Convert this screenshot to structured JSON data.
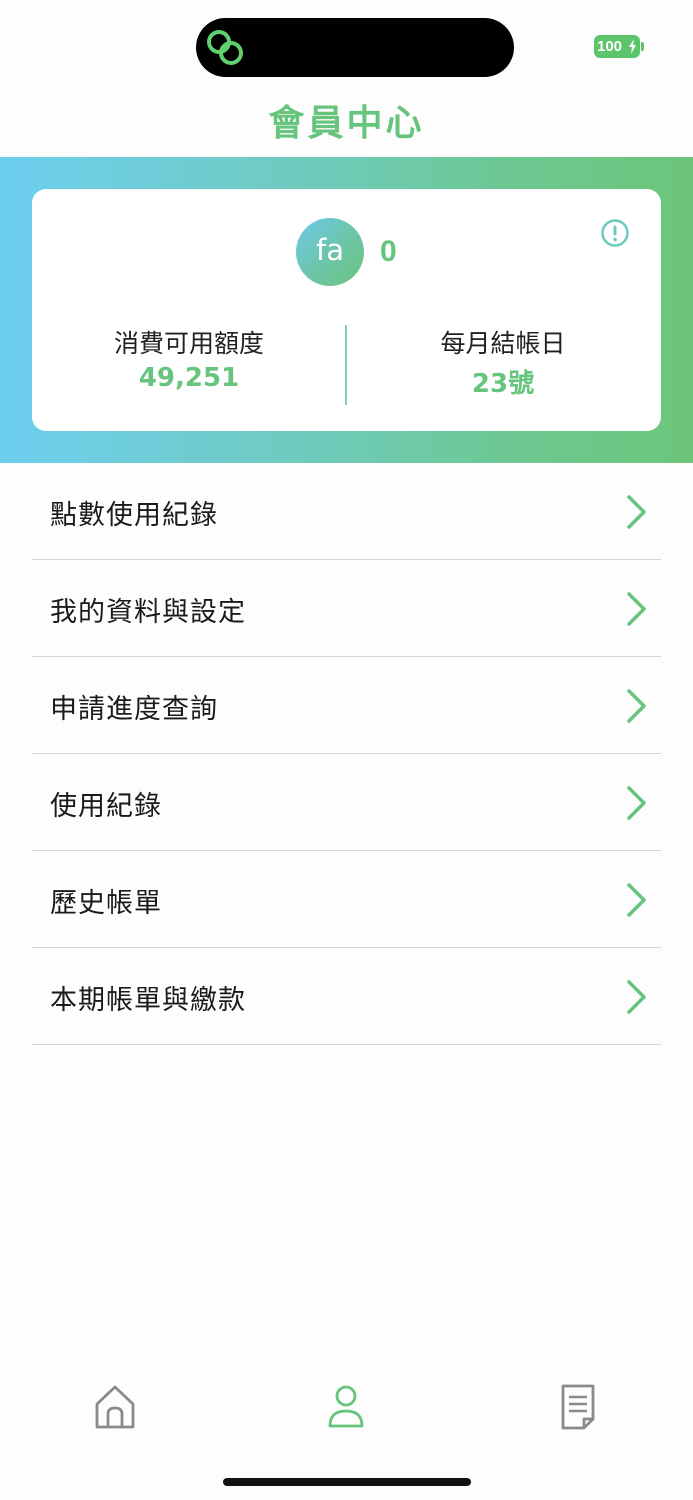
{
  "status_bar": {
    "battery_level": "100",
    "app_icon": "link-rings-icon"
  },
  "header": {
    "title": "會員中心"
  },
  "member_card": {
    "avatar_text": "fa",
    "points": "0",
    "info_icon": "info-circle-icon",
    "available_credit_label": "消費可用額度",
    "available_credit_value": "49,251",
    "billing_day_label": "每月結帳日",
    "billing_day_value": "23號"
  },
  "menu": {
    "items": [
      {
        "label": "點數使用紀錄"
      },
      {
        "label": "我的資料與設定"
      },
      {
        "label": "申請進度查詢"
      },
      {
        "label": "使用紀錄"
      },
      {
        "label": "歷史帳單"
      },
      {
        "label": "本期帳單與繳款"
      }
    ]
  },
  "tab_bar": {
    "tabs": [
      {
        "name": "home",
        "icon": "home-icon",
        "active": false
      },
      {
        "name": "member",
        "icon": "person-icon",
        "active": true
      },
      {
        "name": "bill",
        "icon": "document-icon",
        "active": false
      }
    ]
  },
  "colors": {
    "accent": "#66c47c",
    "gradient_start": "#6dcff0",
    "gradient_end": "#6cc579",
    "divider": "#d6d6d6",
    "icon_gray": "#8a8a8a"
  }
}
